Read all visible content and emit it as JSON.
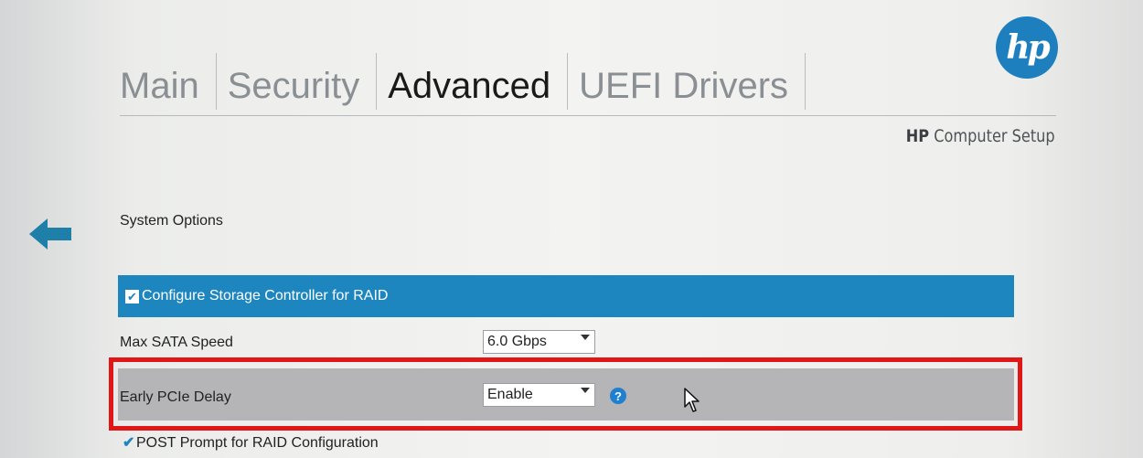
{
  "tabs": [
    {
      "label": "Main",
      "active": false
    },
    {
      "label": "Security",
      "active": false
    },
    {
      "label": "Advanced",
      "active": true
    },
    {
      "label": "UEFI Drivers",
      "active": false
    }
  ],
  "brand": {
    "logo_text": "hp",
    "title_bold": "HP",
    "title_rest": " Computer Setup",
    "color": "#1e7fbf"
  },
  "section": {
    "title": "System Options"
  },
  "options": {
    "raid": {
      "label": "Configure Storage Controller for RAID",
      "checked": true,
      "icon": "checkbox-icon"
    },
    "sata": {
      "label": "Max SATA Speed",
      "value": "6.0 Gbps"
    },
    "pcie": {
      "label": "Early PCIe Delay",
      "value": "Enable",
      "help": "?"
    },
    "post": {
      "label": "POST Prompt for RAID Configuration",
      "checked": true,
      "icon": "checkmark-icon"
    }
  },
  "colors": {
    "selection_bar": "#1e86bf",
    "highlight_row": "#b5b5b7",
    "annotation_box": "#e11616",
    "help_icon": "#1f7fd0"
  }
}
